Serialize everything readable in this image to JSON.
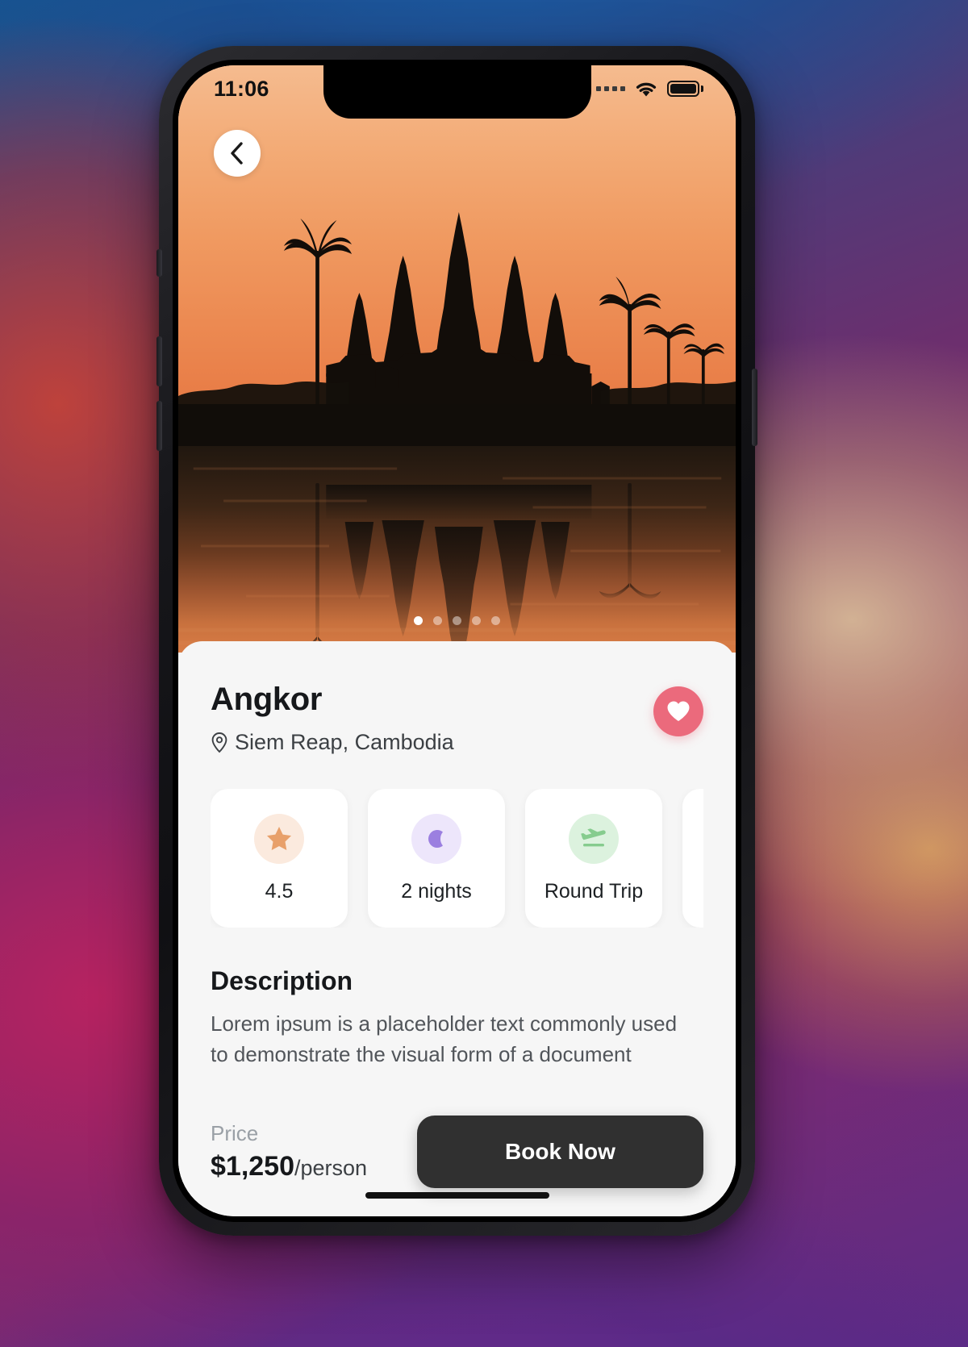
{
  "status_bar": {
    "time": "11:06",
    "signal_icon": "signal-dots-icon",
    "wifi_icon": "wifi-icon",
    "battery_icon": "battery-full-icon"
  },
  "hero": {
    "back_icon": "chevron-left-icon",
    "image_alt": "Angkor Wat temple silhouette at sunset reflected in water",
    "pager": {
      "total": 5,
      "active_index": 0
    }
  },
  "detail": {
    "title": "Angkor",
    "location": "Siem Reap, Cambodia",
    "location_icon": "map-pin-icon",
    "favorite": {
      "icon": "heart-icon",
      "active": true,
      "color": "#eb6a7c"
    },
    "chips": [
      {
        "icon": "star-icon",
        "label": "4.5",
        "icon_color": "#e8a06a",
        "bg_color": "#fbeade"
      },
      {
        "icon": "moon-icon",
        "label": "2 nights",
        "icon_color": "#9b7fe0",
        "bg_color": "#ede6fb"
      },
      {
        "icon": "plane-takeoff-icon",
        "label": "Round Trip",
        "icon_color": "#86cc8e",
        "bg_color": "#dcf2de"
      },
      {
        "icon": "partial-chip-icon",
        "label": "",
        "icon_color": "#cccccc",
        "bg_color": "#f0f0f0"
      }
    ],
    "description_heading": "Description",
    "description_text": "Lorem ipsum is a placeholder text commonly used to demonstrate the visual form of a document"
  },
  "footer": {
    "price_label": "Price",
    "price_amount": "$1,250",
    "price_unit": "/person",
    "book_label": "Book Now"
  },
  "theme": {
    "sheet_bg": "#f6f6f6",
    "accent": "#eb6a7c",
    "button_dark": "#303030",
    "sunset_top": "#f5bb8f",
    "sunset_bottom": "#e0763f"
  }
}
